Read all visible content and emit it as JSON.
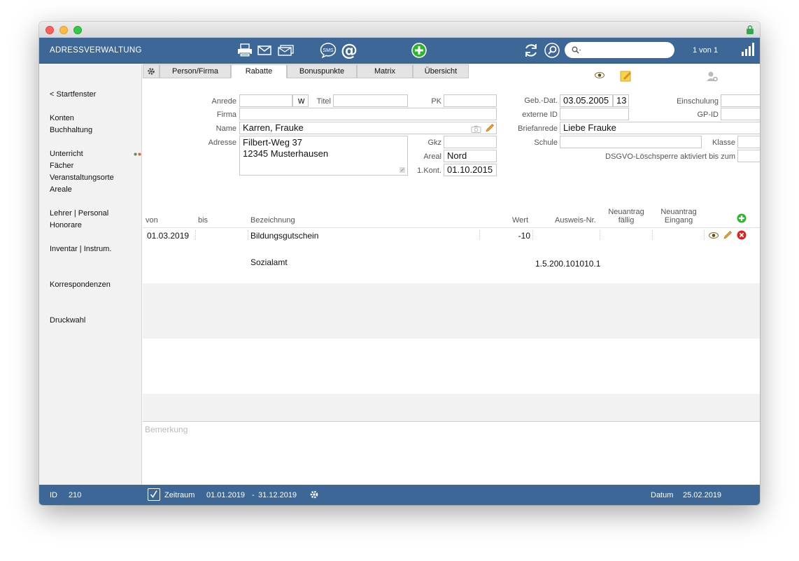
{
  "app": {
    "title": "ADRESSVERWALTUNG"
  },
  "toolbar": {
    "sms_label": "SMS",
    "at_label": "@",
    "search_placeholder": "",
    "counter": "1 von 1"
  },
  "sidebar": {
    "items": [
      "< Startfenster",
      "Konten",
      "Buchhaltung",
      "Unterricht",
      "Fächer",
      "Veranstaltungsorte",
      "Areale",
      "Lehrer | Personal",
      "Honorare",
      "Inventar | Instrum.",
      "Korrespondenzen",
      "Druckwahl"
    ]
  },
  "tabs": [
    "Person/Firma",
    "Rabatte",
    "Bonuspunkte",
    "Matrix",
    "Übersicht"
  ],
  "form": {
    "anrede_label": "Anrede",
    "anrede_value": "",
    "anrede_gender": "w",
    "titel_label": "Titel",
    "titel_value": "",
    "pk_label": "PK",
    "pk_value": "",
    "firma_label": "Firma",
    "firma_value": "",
    "name_label": "Name",
    "name_value": "Karren, Frauke",
    "adresse_label": "Adresse",
    "adresse_line1": "Filbert-Weg 37",
    "adresse_line2": "12345 Musterhausen",
    "gkz_label": "Gkz",
    "gkz_value": "",
    "areal_label": "Areal",
    "areal_value": "Nord",
    "kont_label": "1.Kont.",
    "kont_value": "01.10.2015",
    "gebdat_label": "Geb.-Dat.",
    "gebdat_value": "03.05.2005",
    "age_value": "13",
    "einschulung_label": "Einschulung",
    "einschulung_value": "",
    "externe_label": "externe ID",
    "externe_value": "",
    "gpid_label": "GP-ID",
    "gpid_value": "",
    "briefanrede_label": "Briefanrede",
    "briefanrede_value": "Liebe Frauke",
    "schule_label": "Schule",
    "schule_value": "",
    "klasse_label": "Klasse",
    "klasse_value": "",
    "dsgvo_label": "DSGVO-Löschsperre aktiviert bis zum",
    "dsgvo_value": ""
  },
  "table": {
    "headers": {
      "von": "von",
      "bis": "bis",
      "bezeichnung": "Bezeichnung",
      "wert": "Wert",
      "ausweis": "Ausweis-Nr.",
      "neu_faellig_1": "Neuantrag",
      "neu_faellig_2": "fällig",
      "neu_eingang_1": "Neuantrag",
      "neu_eingang_2": "Eingang"
    },
    "rows": [
      {
        "von": "01.03.2019",
        "bis": "",
        "bezeichnung": "Bildungsgutschein",
        "bezeichnung2": "Sozialamt",
        "wert": "-10",
        "ausweis": "1.5.200.101010.1",
        "faellig": "",
        "eingang": ""
      }
    ]
  },
  "bemerkung": {
    "placeholder": "Bemerkung"
  },
  "status": {
    "id_label": "ID",
    "id_value": "210",
    "zeitraum_label": "Zeitraum",
    "zeitraum_from": "01.01.2019",
    "zeitraum_sep": "-",
    "zeitraum_to": "31.12.2019",
    "datum_label": "Datum",
    "datum_value": "25.02.2019"
  },
  "colors": {
    "toolbar": "#3d6796",
    "accent_green": "#2db52d",
    "delete_red": "#e02020",
    "sidebar_bg": "#f2f2f2"
  }
}
